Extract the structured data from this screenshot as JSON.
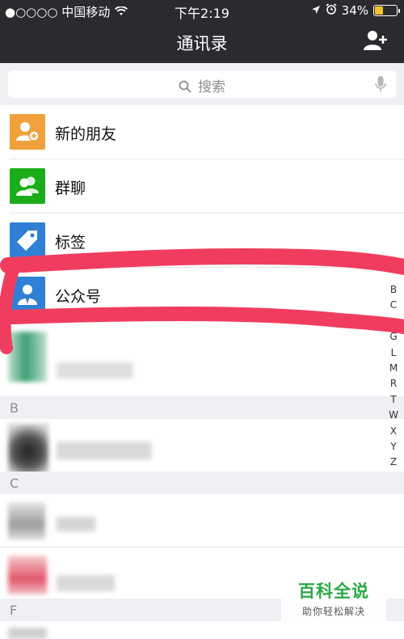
{
  "status_bar": {
    "carrier": "●○○○○ 中国移动",
    "time": "下午2:19",
    "battery": "34%",
    "battery_level": 0.34
  },
  "nav": {
    "title": "通讯录",
    "add_icon": "add-contact-icon"
  },
  "search": {
    "placeholder": "搜索"
  },
  "menu_items": [
    {
      "label": "新的朋友",
      "icon": "new-friend-icon",
      "color": "#f0a13b"
    },
    {
      "label": "群聊",
      "icon": "group-chat-icon",
      "color": "#1aad19"
    },
    {
      "label": "标签",
      "icon": "tag-icon",
      "color": "#2f7fd4"
    },
    {
      "label": "公众号",
      "icon": "official-account-icon",
      "color": "#2f7fd4"
    }
  ],
  "sections": [
    "B",
    "C",
    "F"
  ],
  "index_letters": [
    "B",
    "C",
    "",
    "G",
    "L",
    "M",
    "R",
    "T",
    "W",
    "X",
    "Y",
    "Z"
  ],
  "watermark": {
    "title": "百科全说",
    "subtitle": "助你轻松解决"
  },
  "colors": {
    "header_bg": "#2b2a2f",
    "highlight_scribble": "#f03d5f",
    "brand_green": "#1aad19"
  }
}
